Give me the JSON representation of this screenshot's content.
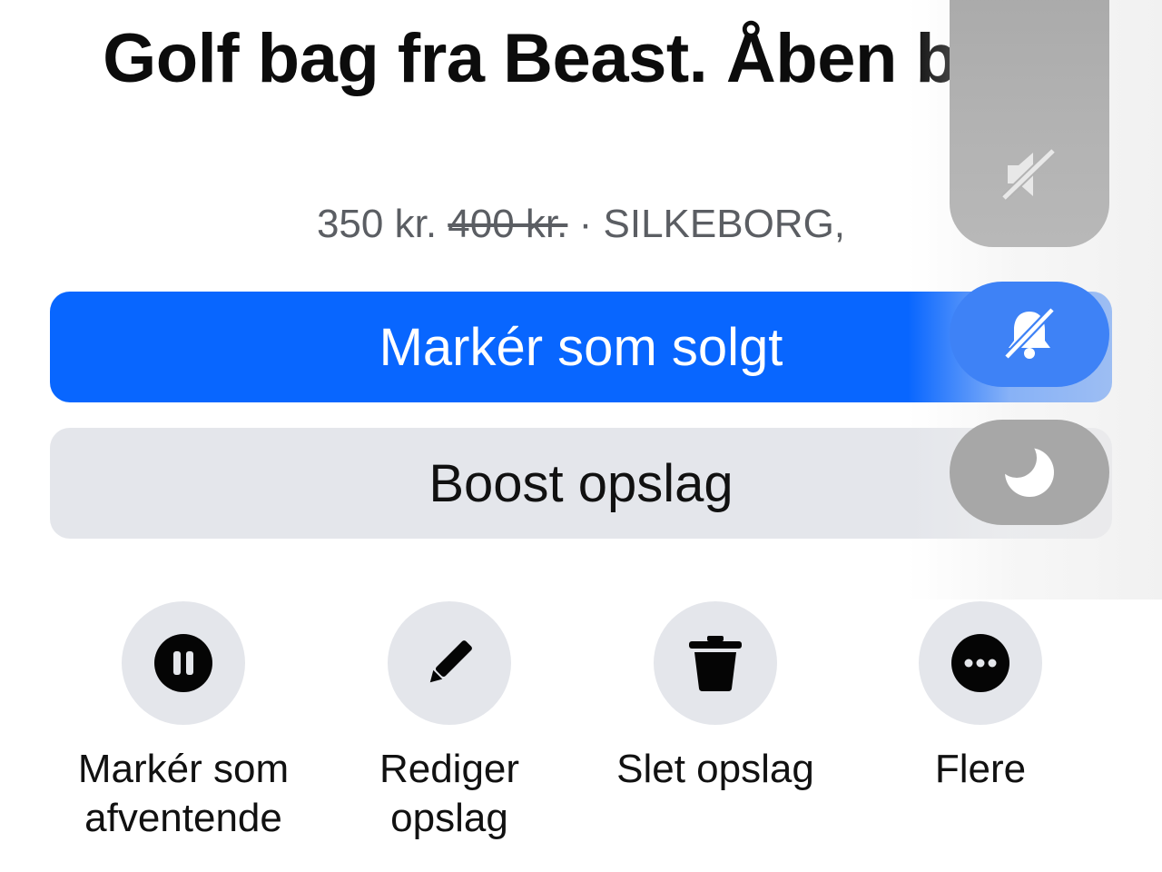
{
  "listing": {
    "title": "Golf bag fra Beast. Åben bud.",
    "price": "350 kr.",
    "old_price": "400 kr.",
    "separator": "·",
    "location": "SILKEBORG,"
  },
  "buttons": {
    "mark_sold": "Markér som solgt",
    "boost": "Boost opslag"
  },
  "actions": [
    {
      "label": "Markér som afventende",
      "icon": "pause-icon"
    },
    {
      "label": "Rediger opslag",
      "icon": "pencil-icon"
    },
    {
      "label": "Slet opslag",
      "icon": "trash-icon"
    },
    {
      "label": "Flere",
      "icon": "more-icon"
    }
  ],
  "overlay": {
    "icons": [
      "sound-muted-icon",
      "bell-off-icon",
      "moon-icon"
    ]
  },
  "colors": {
    "primary": "#0866ff",
    "secondary_bg": "#e4e6eb",
    "overlay_active": "#3e82f6",
    "overlay_inactive": "#a7a7a7"
  }
}
